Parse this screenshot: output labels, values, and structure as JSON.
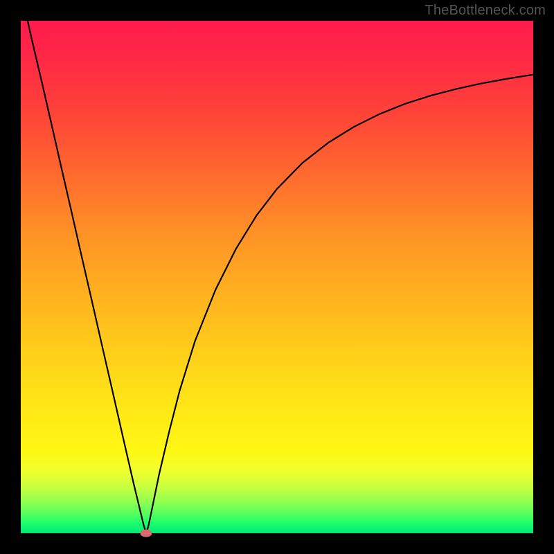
{
  "watermark": "TheBottleneck.com",
  "colors": {
    "frame": "#000000",
    "curve_stroke": "#000000",
    "dot_fill": "#d96a6e",
    "gradient_top": "#ff1a4d",
    "gradient_bottom": "#00e874"
  },
  "chart_data": {
    "type": "line",
    "title": "",
    "xlabel": "",
    "ylabel": "",
    "xlim": [
      0,
      100
    ],
    "ylim": [
      0,
      100
    ],
    "grid": false,
    "legend": false,
    "series": [
      {
        "name": "bottleneck-curve",
        "x": [
          0,
          2,
          4,
          6,
          8,
          10,
          12,
          14,
          16,
          18,
          20,
          22,
          24,
          24.5,
          25,
          27,
          29,
          31,
          34,
          38,
          42,
          46,
          50,
          55,
          60,
          65,
          70,
          75,
          80,
          85,
          90,
          95,
          100
        ],
        "y": [
          106,
          97,
          88.5,
          79.8,
          71.0,
          62.3,
          53.5,
          44.8,
          36.0,
          27.3,
          18.5,
          9.8,
          1.5,
          0.0,
          1.8,
          11.5,
          20.0,
          27.8,
          37.5,
          47.5,
          55.5,
          62.0,
          67.2,
          72.3,
          76.2,
          79.3,
          81.8,
          83.8,
          85.4,
          86.7,
          87.8,
          88.7,
          89.5
        ]
      }
    ],
    "marker": {
      "x": 24.5,
      "y": 0,
      "shape": "ellipse",
      "color": "#d96a6e"
    },
    "background": "vertical-gradient red-yellow-green",
    "axes_visible": false
  }
}
